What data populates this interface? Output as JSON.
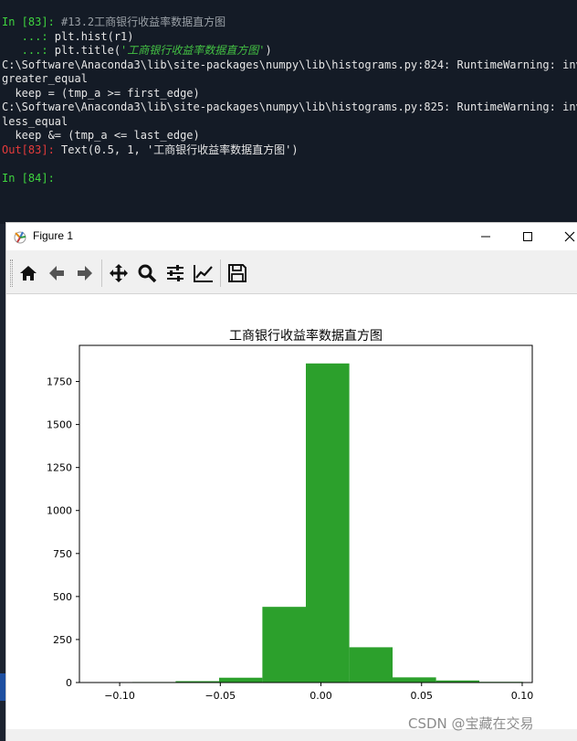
{
  "terminal": {
    "lines": [
      {
        "p1": "In [83]: ",
        "p2": "#13.2工商银行收益率数据直方图",
        "p3": "",
        "p4": ""
      },
      {
        "p1": "",
        "p2": "   ...: ",
        "p3": "plt.hist(r1)",
        "p4": ""
      },
      {
        "p1": "",
        "p2": "   ...: ",
        "p3": "plt.title(",
        "p4": "'工商银行收益率数据直方图'",
        "p5": ")"
      },
      {
        "text": "C:\\Software\\Anaconda3\\lib\\site-packages\\numpy\\lib\\histograms.py:824: RuntimeWarning: invalid value encountered in"
      },
      {
        "text": "greater_equal"
      },
      {
        "text": "  keep = (tmp_a >= first_edge)"
      },
      {
        "text": "C:\\Software\\Anaconda3\\lib\\site-packages\\numpy\\lib\\histograms.py:825: RuntimeWarning: invalid value encountered in"
      },
      {
        "text": "less_equal"
      },
      {
        "text": "  keep &= (tmp_a <= last_edge)"
      },
      {
        "out": "Out[83]: ",
        "text": "Text(0.5, 1, '工商银行收益率数据直方图')"
      },
      {
        "text": ""
      },
      {
        "in": "In [84]:",
        "text": ""
      }
    ]
  },
  "window": {
    "title": "Figure 1",
    "controls": [
      "minimize-icon",
      "maximize-icon",
      "close-icon"
    ]
  },
  "toolbar": {
    "tools": [
      "home-icon",
      "back-arrow-icon",
      "forward-arrow-icon",
      "pan-icon",
      "zoom-icon",
      "configure-subplots-icon",
      "edit-axis-icon",
      "save-icon"
    ]
  },
  "watermark": "CSDN @宝藏在交易",
  "chart_data": {
    "type": "bar",
    "title": "工商银行收益率数据直方图",
    "xlabel": "",
    "ylabel": "",
    "bar_color": "#2ca02c",
    "xlim": [
      -0.12,
      0.105
    ],
    "ylim": [
      0,
      1960
    ],
    "xticks": [
      -0.1,
      -0.05,
      0.0,
      0.05,
      0.1
    ],
    "xtick_labels": [
      "−0.10",
      "−0.05",
      "0.00",
      "0.05",
      "0.10"
    ],
    "yticks": [
      0,
      250,
      500,
      750,
      1000,
      1250,
      1500,
      1750
    ],
    "ytick_labels": [
      "0",
      "250",
      "500",
      "750",
      "1000",
      "1250",
      "1500",
      "1750"
    ],
    "bins": [
      {
        "x0": -0.1153,
        "x1": -0.0937,
        "value": 2
      },
      {
        "x0": -0.0937,
        "x1": -0.0722,
        "value": 3
      },
      {
        "x0": -0.0722,
        "x1": -0.0506,
        "value": 8
      },
      {
        "x0": -0.0506,
        "x1": -0.0291,
        "value": 28
      },
      {
        "x0": -0.0291,
        "x1": -0.0075,
        "value": 440
      },
      {
        "x0": -0.0075,
        "x1": 0.0141,
        "value": 1855
      },
      {
        "x0": 0.0141,
        "x1": 0.0356,
        "value": 205
      },
      {
        "x0": 0.0356,
        "x1": 0.0572,
        "value": 30
      },
      {
        "x0": 0.0572,
        "x1": 0.0787,
        "value": 12
      },
      {
        "x0": 0.0787,
        "x1": 0.1003,
        "value": 4
      }
    ]
  }
}
